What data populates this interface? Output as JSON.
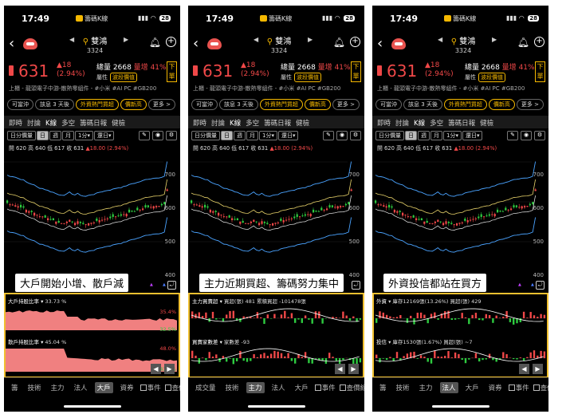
{
  "status": {
    "time": "17:49",
    "app_tag": "籌碼K線",
    "battery": "28"
  },
  "stock": {
    "name": "雙鴻",
    "code": "3324",
    "price": "631",
    "change_arrow": "▲18",
    "change_pct": "(2.94%)",
    "volume_label": "總量",
    "volume": "2668",
    "ratio_label": "量增",
    "ratio": "41%",
    "attribute_label": "屬性",
    "attribute_tag": "波段價值",
    "order_label": "下單"
  },
  "industry": "上櫃 - 龍頭電子中游-散熱零組件 - #小米 #AI PC #GB200",
  "chips": [
    "可當沖",
    "該息 3 天後",
    "外資熱門買超",
    "價新高",
    "更多 >"
  ],
  "tabs": [
    "即時",
    "討論",
    "K線",
    "多空",
    "籌碼日報",
    "健檢"
  ],
  "tools": {
    "volume_label": "日分價量",
    "day": "日",
    "week": "週",
    "month": "月",
    "min": "1分▾",
    "rights": "還日▾"
  },
  "ohlc": {
    "open": "開 620",
    "high": "高 640",
    "low": "低 617",
    "close": "收 631",
    "change": "▲18.00 (2.94%)"
  },
  "yaxis": [
    "700",
    "600",
    "500",
    "400"
  ],
  "panels": [
    {
      "caption": "大戶開始小增、散戶減",
      "label_a": "大戶持股比率 ▾",
      "value_a": "33.73 %",
      "ticks_a": [
        "35.4%",
        "32.5%"
      ],
      "label_b": "散戶持股比率 ▾",
      "value_b": "45.04 %",
      "ticks_b": [
        "48.0%",
        "43.0%"
      ],
      "tabs": [
        "籌",
        "技術",
        "主力",
        "法人",
        "大戶",
        "資券"
      ],
      "active": "大戶",
      "check_a": "事件",
      "check_b": "查價線"
    },
    {
      "caption": "主力近期買超、籌碼努力集中",
      "label_a": "主力買賣超 ▾",
      "value_a": "買超(張) 481  累積買超 -101478張",
      "ticks_a": [
        "",
        ""
      ],
      "label_b": "買賣家數差 ▾",
      "value_b": "家數差 -93",
      "ticks_b": [
        "",
        ""
      ],
      "tabs": [
        "成交量",
        "技術",
        "主力",
        "法人",
        "大戶"
      ],
      "active": "主力",
      "check_a": "事件",
      "check_b": "查價線"
    },
    {
      "caption": "外資投信都站在買方",
      "label_a": "外資",
      "value_a": "▾  庫存12169張(13.26%) 買超(張) 429",
      "ticks_a": [
        "",
        ""
      ],
      "label_b": "投信",
      "value_b": "▾  庫存1530張(1.67%) 買超(張) ~7",
      "ticks_b": [
        "",
        ""
      ],
      "tabs": [
        "籌",
        "技術",
        "主力",
        "法人",
        "大戶",
        "資券"
      ],
      "active": "法人",
      "check_a": "事件",
      "check_b": "查價線"
    }
  ],
  "colors": {
    "up": "#f04848",
    "down": "#2ecc40",
    "accent": "#f5b800",
    "frame": "#f0c030"
  },
  "chart_data": {
    "type": "candlestick",
    "ylim": [
      400,
      720
    ],
    "yticks": [
      700,
      600,
      500,
      400
    ],
    "last_close": 631,
    "open": 620,
    "high": 640,
    "low": 617
  }
}
